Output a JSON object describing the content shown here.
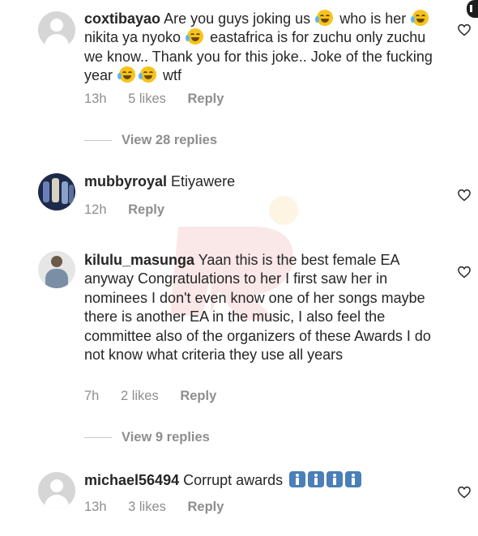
{
  "comments": [
    {
      "username": "coxtibayao",
      "segments": [
        "Are you guys joking us",
        "who is her",
        "nikita ya nyoko",
        "eastafrica is for zuchu only zuchu we know.. Thank you for this joke.. Joke of the fucking year",
        "wtf"
      ],
      "time": "13h",
      "likes": "5 likes",
      "reply": "Reply"
    },
    {
      "username": "mubbyroyal",
      "text": "Etiyawere",
      "time": "12h",
      "reply": "Reply"
    },
    {
      "username": "kilulu_masunga",
      "text": "Yaan this is the best female EA anyway Congratulations to her I first saw her in nominees I don't even know one of her songs maybe there is another EA in the music, I also feel the committee also of the organizers of these Awards I do not know what criteria they use all years",
      "time": "7h",
      "likes": "2 likes",
      "reply": "Reply"
    },
    {
      "username": "michael56494",
      "text": "Corrupt awards",
      "time": "13h",
      "likes": "3 likes",
      "reply": "Reply"
    }
  ],
  "view_replies": [
    "View 28 replies",
    "View 9 replies"
  ],
  "icons": {
    "heart": "heart-outline-icon",
    "emoji_laugh": "face-with-tears-of-joy-icon",
    "emoji_man": "man-gesture-icon"
  },
  "colors": {
    "text": "#262626",
    "secondary": "#8e8e8e"
  }
}
